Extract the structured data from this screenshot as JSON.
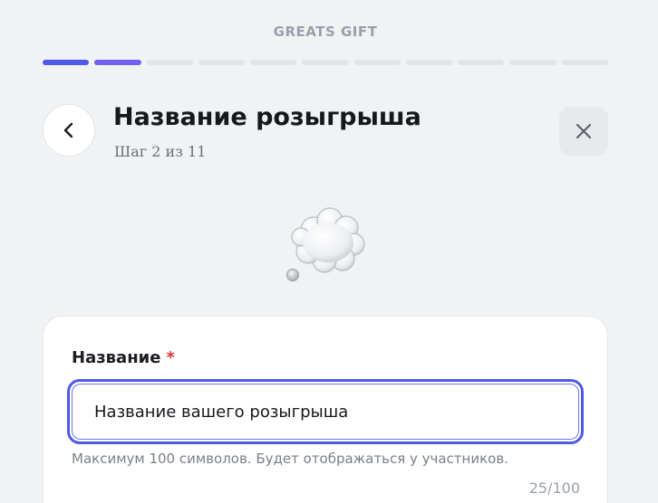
{
  "app": {
    "brand": "GREATS GIFT"
  },
  "progress": {
    "total_steps": 11,
    "completed_steps": 2
  },
  "header": {
    "title": "Название розыгрыша",
    "subtitle": "Шаг 2 из 11",
    "back_icon": "chevron-left-icon",
    "close_icon": "close-icon"
  },
  "illustration": {
    "icon": "thought-balloon-icon"
  },
  "form": {
    "label": "Название",
    "required_mark": "*",
    "input_value": "Название вашего розыгрыша",
    "hint": "Максимум 100 символов. Будет отображаться у участников.",
    "counter": "25/100"
  },
  "colors": {
    "accent": "#4f5be8",
    "accent_secondary": "#7261ee",
    "required": "#e0323c",
    "background": "#f1f2f4"
  }
}
